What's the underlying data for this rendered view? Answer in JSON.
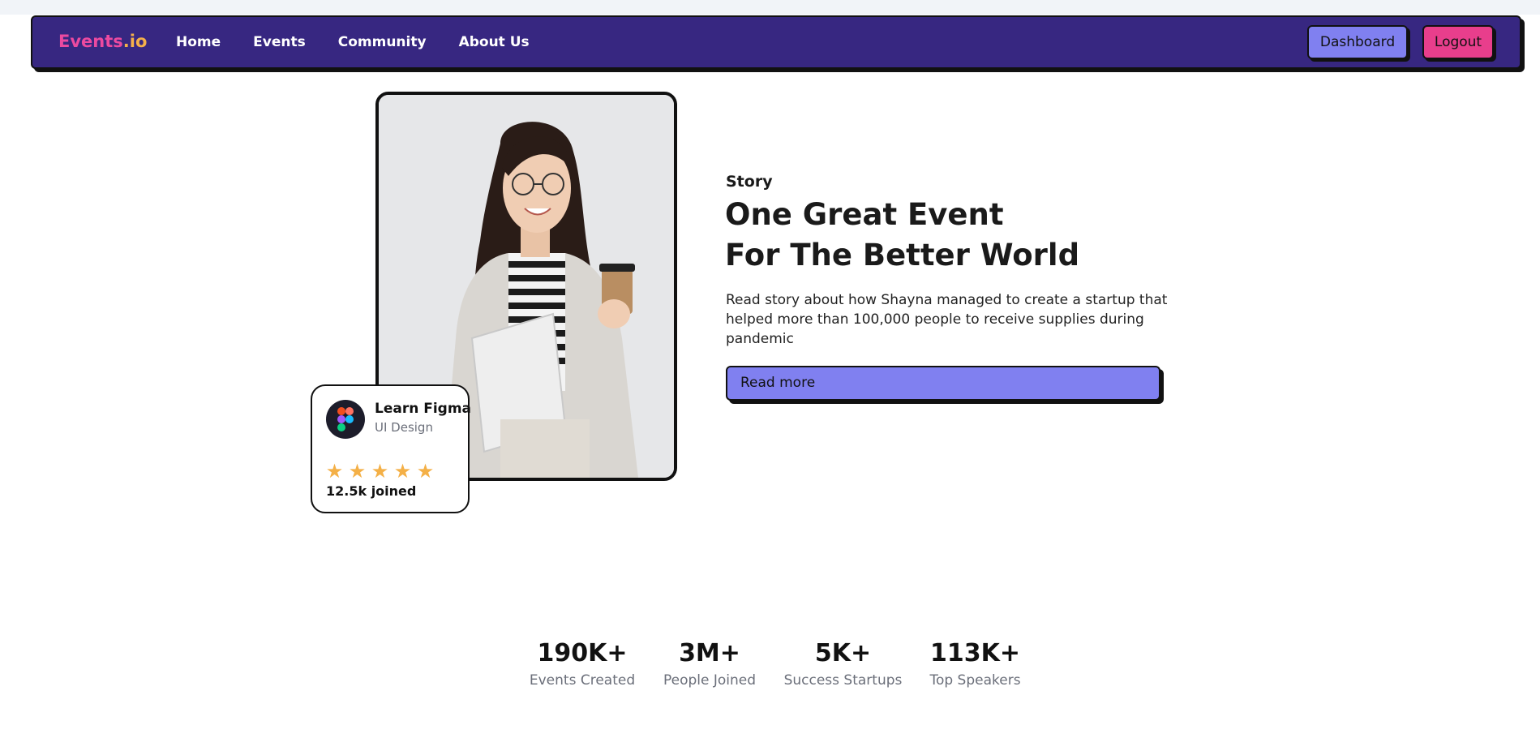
{
  "nav": {
    "logo_part1": "Events",
    "logo_part2": ".io",
    "links": [
      "Home",
      "Events",
      "Community",
      "About Us"
    ],
    "dashboard_label": "Dashboard",
    "logout_label": "Logout"
  },
  "badge": {
    "title": "Learn Figma",
    "subtitle": "UI Design",
    "rating_stars": 5,
    "joined": "12.5k joined",
    "icon": "figma-icon"
  },
  "hero": {
    "label": "Story",
    "headline_line1": "One Great Event",
    "headline_line2": "For The Better World",
    "description": "Read story about how Shayna managed to create a startup that helped more than 100,000 people to receive supplies during pandemic",
    "cta_label": "Read more"
  },
  "stats": [
    {
      "value": "190K+",
      "label": "Events Created"
    },
    {
      "value": "3M+",
      "label": "People Joined"
    },
    {
      "value": "5K+",
      "label": "Success Startups"
    },
    {
      "value": "113K+",
      "label": "Top Speakers"
    }
  ],
  "colors": {
    "navbar": "#372781",
    "primary_button": "#8080f0",
    "logout_button": "#e83e8c",
    "star": "#f4b047"
  }
}
